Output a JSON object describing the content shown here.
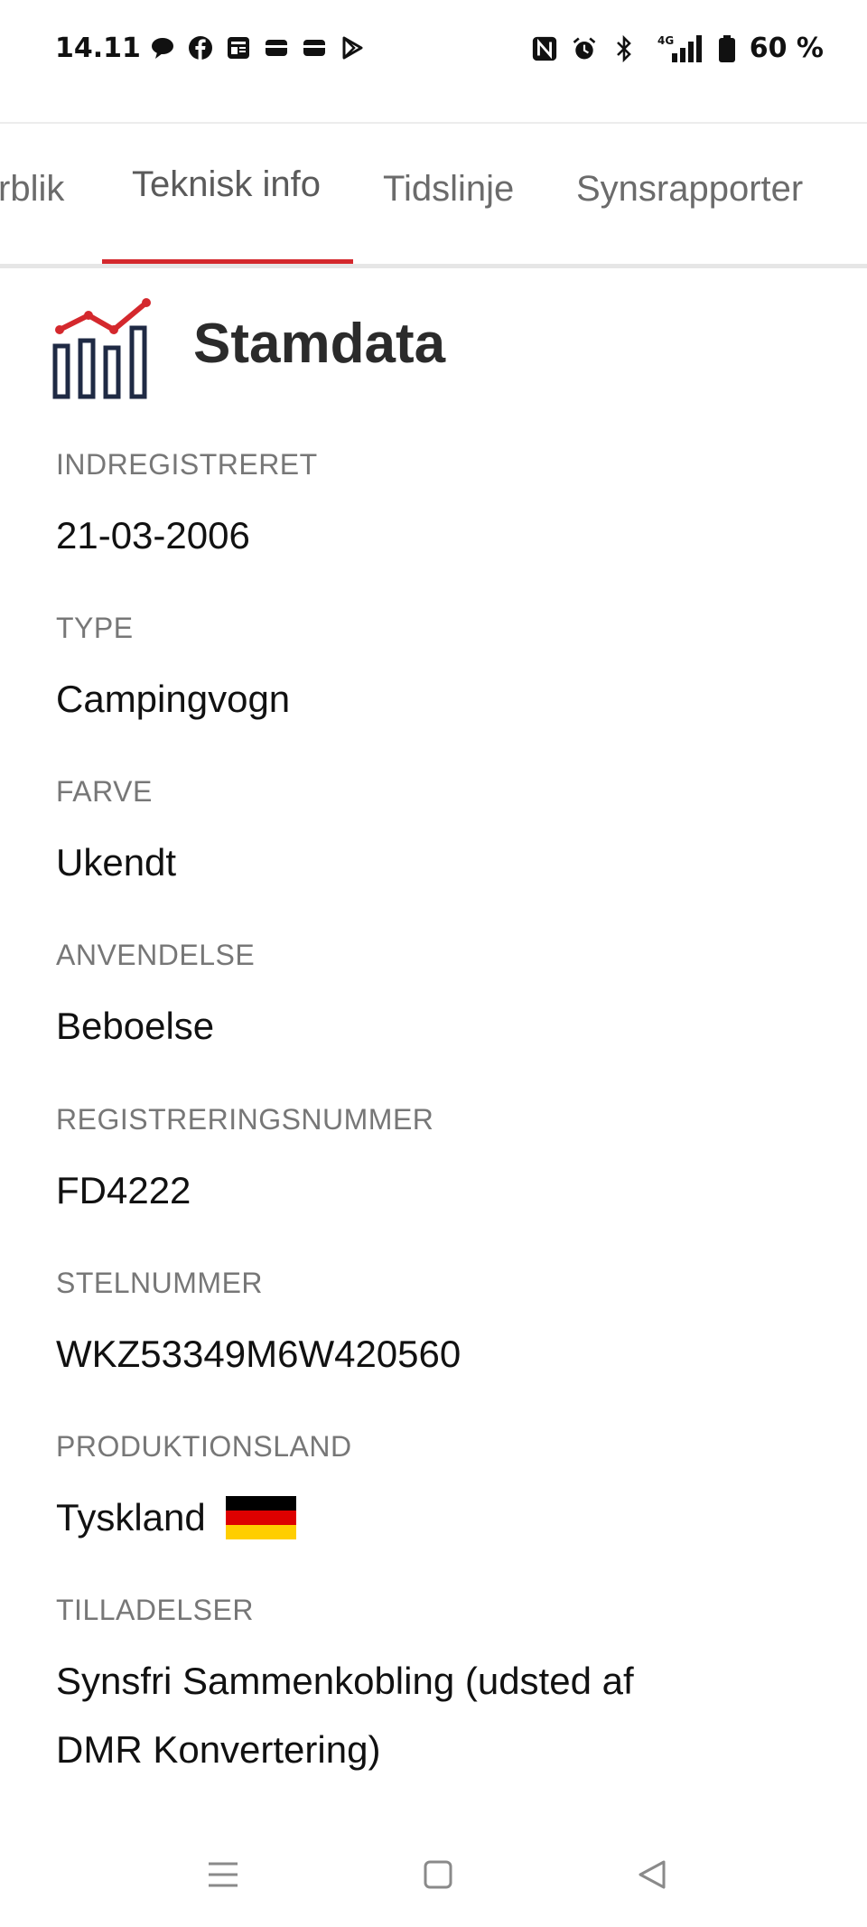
{
  "status_bar": {
    "time": "14.11",
    "network": "4G",
    "battery": "60 %"
  },
  "tabs": [
    {
      "label": "rblik"
    },
    {
      "label": "Teknisk info",
      "active": true
    },
    {
      "label": "Tidslinje"
    },
    {
      "label": "Synsrapporter"
    }
  ],
  "section": {
    "title": "Stamdata",
    "icon": "bar-chart-trend-icon"
  },
  "fields": [
    {
      "label": "INDREGISTRERET",
      "value": "21-03-2006"
    },
    {
      "label": "TYPE",
      "value": "Campingvogn"
    },
    {
      "label": "FARVE",
      "value": "Ukendt"
    },
    {
      "label": "ANVENDELSE",
      "value": "Beboelse"
    },
    {
      "label": "REGISTRERINGSNUMMER",
      "value": "FD4222"
    },
    {
      "label": "STELNUMMER",
      "value": "WKZ53349M6W420560"
    },
    {
      "label": "PRODUKTIONSLAND",
      "value": "Tyskland",
      "flag": "germany-flag-icon"
    },
    {
      "label": "TILLADELSER",
      "value_line1": "Synsfri Sammenkobling (udsted af",
      "value_line2": "DMR Konvertering)"
    }
  ],
  "colors": {
    "accent": "#d4282d",
    "icon_dark": "#1f2a44",
    "label_gray": "#777777"
  }
}
